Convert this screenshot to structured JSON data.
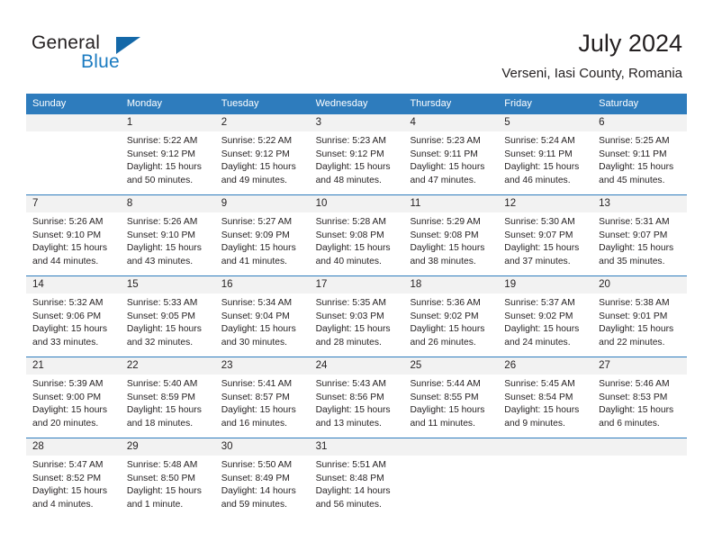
{
  "brand": {
    "name_part1": "General",
    "name_part2": "Blue",
    "logo_icon": "triangle-flag-icon"
  },
  "header": {
    "title": "July 2024",
    "location": "Verseni, Iasi County, Romania"
  },
  "colors": {
    "header_blue": "#2E7CBD",
    "brand_blue": "#1B7BC1",
    "logo_blue": "#1468A8",
    "daynum_band": "#F2F2F2",
    "text": "#231F20"
  },
  "calendar": {
    "weekday_headers": [
      "Sunday",
      "Monday",
      "Tuesday",
      "Wednesday",
      "Thursday",
      "Friday",
      "Saturday"
    ],
    "weeks": [
      [
        {
          "day": "",
          "sunrise": "",
          "sunset": "",
          "daylight_line1": "",
          "daylight_line2": "",
          "empty": true
        },
        {
          "day": "1",
          "sunrise": "Sunrise: 5:22 AM",
          "sunset": "Sunset: 9:12 PM",
          "daylight_line1": "Daylight: 15 hours",
          "daylight_line2": "and 50 minutes."
        },
        {
          "day": "2",
          "sunrise": "Sunrise: 5:22 AM",
          "sunset": "Sunset: 9:12 PM",
          "daylight_line1": "Daylight: 15 hours",
          "daylight_line2": "and 49 minutes."
        },
        {
          "day": "3",
          "sunrise": "Sunrise: 5:23 AM",
          "sunset": "Sunset: 9:12 PM",
          "daylight_line1": "Daylight: 15 hours",
          "daylight_line2": "and 48 minutes."
        },
        {
          "day": "4",
          "sunrise": "Sunrise: 5:23 AM",
          "sunset": "Sunset: 9:11 PM",
          "daylight_line1": "Daylight: 15 hours",
          "daylight_line2": "and 47 minutes."
        },
        {
          "day": "5",
          "sunrise": "Sunrise: 5:24 AM",
          "sunset": "Sunset: 9:11 PM",
          "daylight_line1": "Daylight: 15 hours",
          "daylight_line2": "and 46 minutes."
        },
        {
          "day": "6",
          "sunrise": "Sunrise: 5:25 AM",
          "sunset": "Sunset: 9:11 PM",
          "daylight_line1": "Daylight: 15 hours",
          "daylight_line2": "and 45 minutes."
        }
      ],
      [
        {
          "day": "7",
          "sunrise": "Sunrise: 5:26 AM",
          "sunset": "Sunset: 9:10 PM",
          "daylight_line1": "Daylight: 15 hours",
          "daylight_line2": "and 44 minutes."
        },
        {
          "day": "8",
          "sunrise": "Sunrise: 5:26 AM",
          "sunset": "Sunset: 9:10 PM",
          "daylight_line1": "Daylight: 15 hours",
          "daylight_line2": "and 43 minutes."
        },
        {
          "day": "9",
          "sunrise": "Sunrise: 5:27 AM",
          "sunset": "Sunset: 9:09 PM",
          "daylight_line1": "Daylight: 15 hours",
          "daylight_line2": "and 41 minutes."
        },
        {
          "day": "10",
          "sunrise": "Sunrise: 5:28 AM",
          "sunset": "Sunset: 9:08 PM",
          "daylight_line1": "Daylight: 15 hours",
          "daylight_line2": "and 40 minutes."
        },
        {
          "day": "11",
          "sunrise": "Sunrise: 5:29 AM",
          "sunset": "Sunset: 9:08 PM",
          "daylight_line1": "Daylight: 15 hours",
          "daylight_line2": "and 38 minutes."
        },
        {
          "day": "12",
          "sunrise": "Sunrise: 5:30 AM",
          "sunset": "Sunset: 9:07 PM",
          "daylight_line1": "Daylight: 15 hours",
          "daylight_line2": "and 37 minutes."
        },
        {
          "day": "13",
          "sunrise": "Sunrise: 5:31 AM",
          "sunset": "Sunset: 9:07 PM",
          "daylight_line1": "Daylight: 15 hours",
          "daylight_line2": "and 35 minutes."
        }
      ],
      [
        {
          "day": "14",
          "sunrise": "Sunrise: 5:32 AM",
          "sunset": "Sunset: 9:06 PM",
          "daylight_line1": "Daylight: 15 hours",
          "daylight_line2": "and 33 minutes."
        },
        {
          "day": "15",
          "sunrise": "Sunrise: 5:33 AM",
          "sunset": "Sunset: 9:05 PM",
          "daylight_line1": "Daylight: 15 hours",
          "daylight_line2": "and 32 minutes."
        },
        {
          "day": "16",
          "sunrise": "Sunrise: 5:34 AM",
          "sunset": "Sunset: 9:04 PM",
          "daylight_line1": "Daylight: 15 hours",
          "daylight_line2": "and 30 minutes."
        },
        {
          "day": "17",
          "sunrise": "Sunrise: 5:35 AM",
          "sunset": "Sunset: 9:03 PM",
          "daylight_line1": "Daylight: 15 hours",
          "daylight_line2": "and 28 minutes."
        },
        {
          "day": "18",
          "sunrise": "Sunrise: 5:36 AM",
          "sunset": "Sunset: 9:02 PM",
          "daylight_line1": "Daylight: 15 hours",
          "daylight_line2": "and 26 minutes."
        },
        {
          "day": "19",
          "sunrise": "Sunrise: 5:37 AM",
          "sunset": "Sunset: 9:02 PM",
          "daylight_line1": "Daylight: 15 hours",
          "daylight_line2": "and 24 minutes."
        },
        {
          "day": "20",
          "sunrise": "Sunrise: 5:38 AM",
          "sunset": "Sunset: 9:01 PM",
          "daylight_line1": "Daylight: 15 hours",
          "daylight_line2": "and 22 minutes."
        }
      ],
      [
        {
          "day": "21",
          "sunrise": "Sunrise: 5:39 AM",
          "sunset": "Sunset: 9:00 PM",
          "daylight_line1": "Daylight: 15 hours",
          "daylight_line2": "and 20 minutes."
        },
        {
          "day": "22",
          "sunrise": "Sunrise: 5:40 AM",
          "sunset": "Sunset: 8:59 PM",
          "daylight_line1": "Daylight: 15 hours",
          "daylight_line2": "and 18 minutes."
        },
        {
          "day": "23",
          "sunrise": "Sunrise: 5:41 AM",
          "sunset": "Sunset: 8:57 PM",
          "daylight_line1": "Daylight: 15 hours",
          "daylight_line2": "and 16 minutes."
        },
        {
          "day": "24",
          "sunrise": "Sunrise: 5:43 AM",
          "sunset": "Sunset: 8:56 PM",
          "daylight_line1": "Daylight: 15 hours",
          "daylight_line2": "and 13 minutes."
        },
        {
          "day": "25",
          "sunrise": "Sunrise: 5:44 AM",
          "sunset": "Sunset: 8:55 PM",
          "daylight_line1": "Daylight: 15 hours",
          "daylight_line2": "and 11 minutes."
        },
        {
          "day": "26",
          "sunrise": "Sunrise: 5:45 AM",
          "sunset": "Sunset: 8:54 PM",
          "daylight_line1": "Daylight: 15 hours",
          "daylight_line2": "and 9 minutes."
        },
        {
          "day": "27",
          "sunrise": "Sunrise: 5:46 AM",
          "sunset": "Sunset: 8:53 PM",
          "daylight_line1": "Daylight: 15 hours",
          "daylight_line2": "and 6 minutes."
        }
      ],
      [
        {
          "day": "28",
          "sunrise": "Sunrise: 5:47 AM",
          "sunset": "Sunset: 8:52 PM",
          "daylight_line1": "Daylight: 15 hours",
          "daylight_line2": "and 4 minutes."
        },
        {
          "day": "29",
          "sunrise": "Sunrise: 5:48 AM",
          "sunset": "Sunset: 8:50 PM",
          "daylight_line1": "Daylight: 15 hours",
          "daylight_line2": "and 1 minute."
        },
        {
          "day": "30",
          "sunrise": "Sunrise: 5:50 AM",
          "sunset": "Sunset: 8:49 PM",
          "daylight_line1": "Daylight: 14 hours",
          "daylight_line2": "and 59 minutes."
        },
        {
          "day": "31",
          "sunrise": "Sunrise: 5:51 AM",
          "sunset": "Sunset: 8:48 PM",
          "daylight_line1": "Daylight: 14 hours",
          "daylight_line2": "and 56 minutes."
        },
        {
          "day": "",
          "sunrise": "",
          "sunset": "",
          "daylight_line1": "",
          "daylight_line2": "",
          "empty": true
        },
        {
          "day": "",
          "sunrise": "",
          "sunset": "",
          "daylight_line1": "",
          "daylight_line2": "",
          "empty": true
        },
        {
          "day": "",
          "sunrise": "",
          "sunset": "",
          "daylight_line1": "",
          "daylight_line2": "",
          "empty": true
        }
      ]
    ]
  }
}
